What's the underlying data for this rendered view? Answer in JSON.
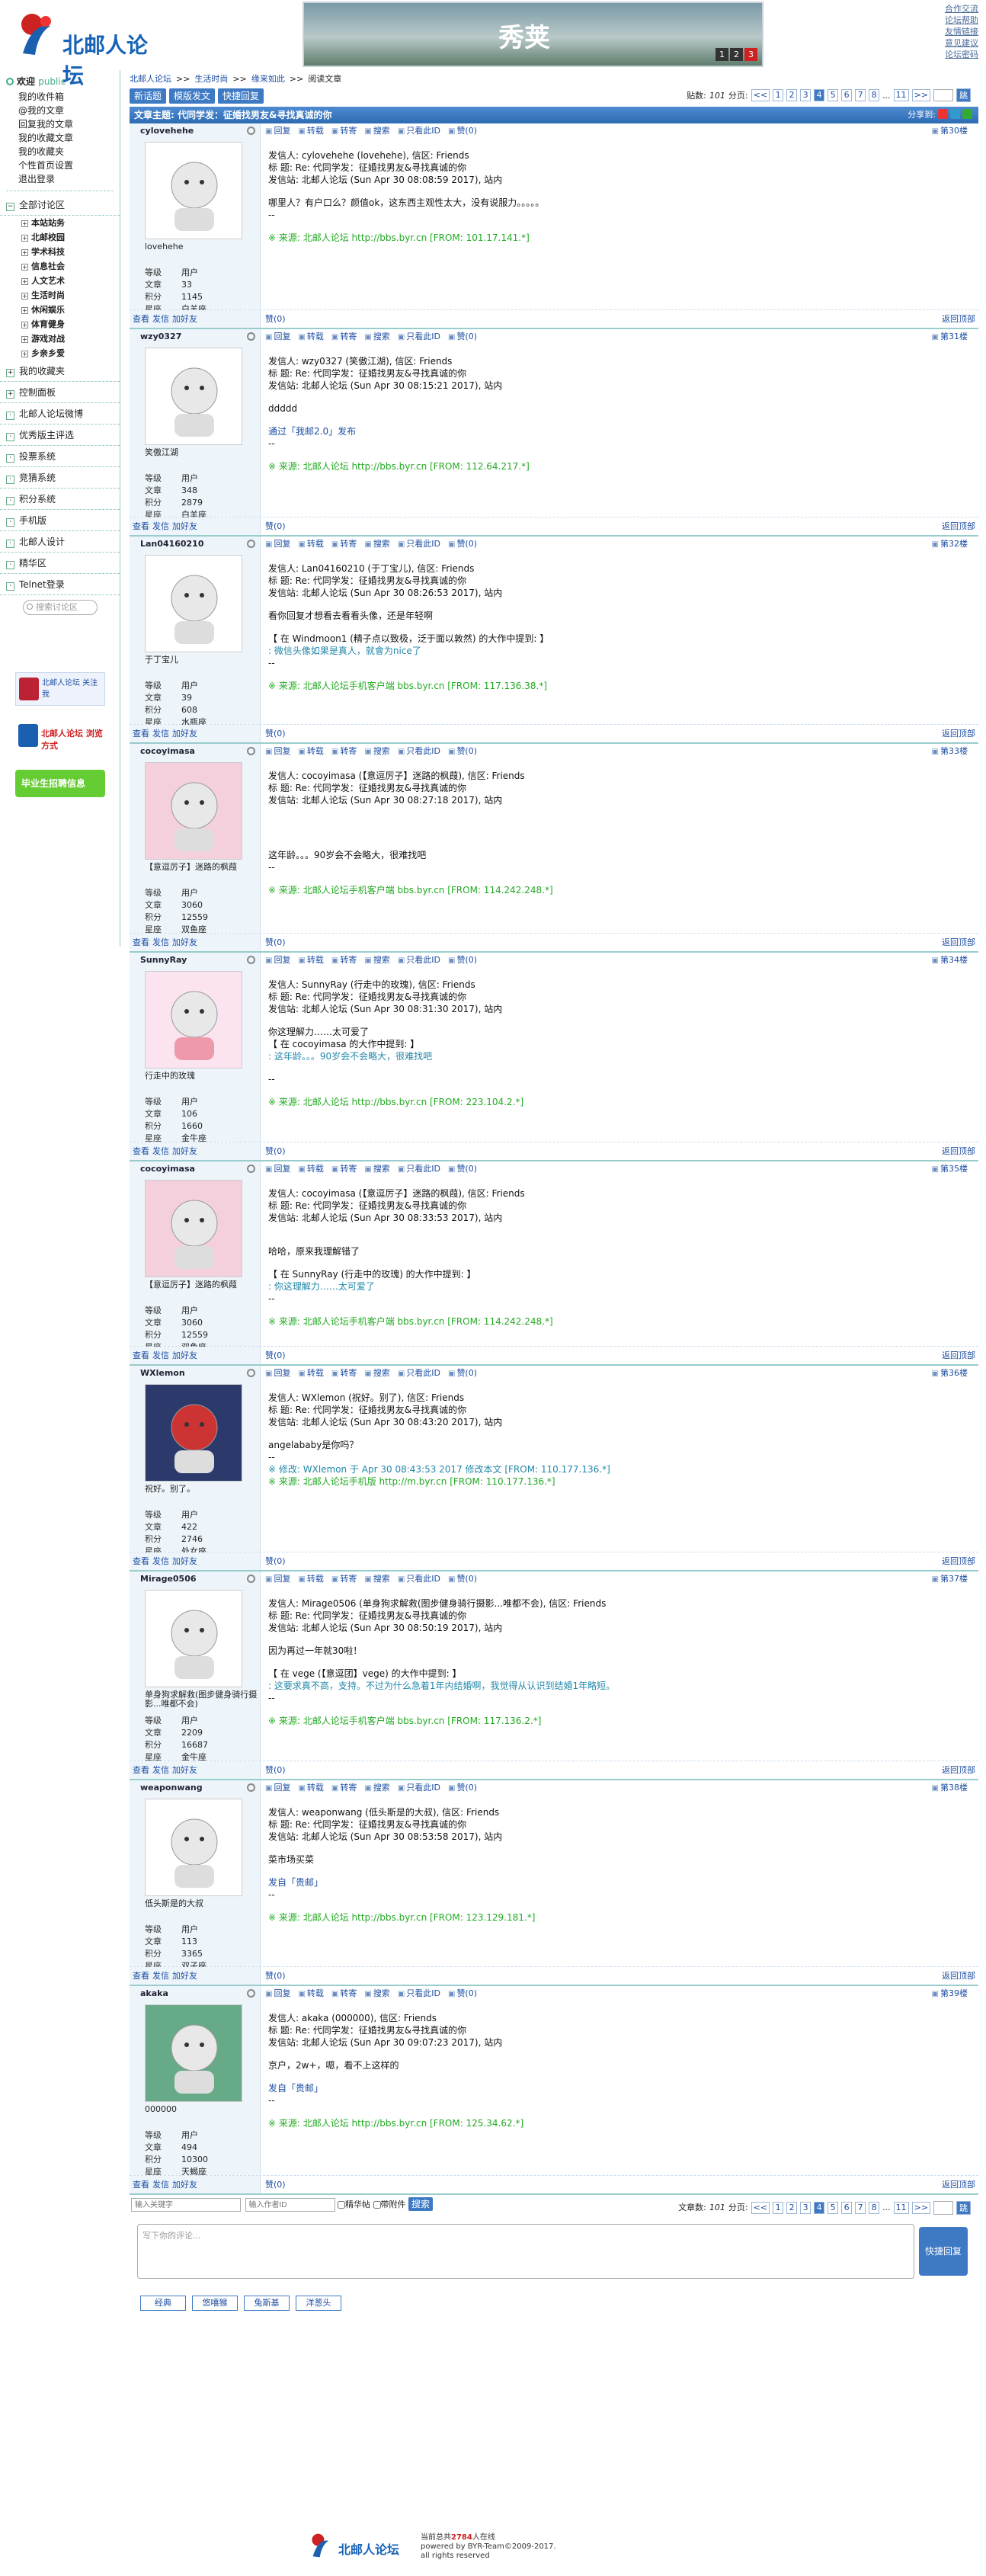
{
  "site": {
    "logo_text": "北邮人论坛",
    "banner_title": "秀荚",
    "banner_pages": [
      "1",
      "2",
      "3"
    ],
    "banner_current": "3",
    "toplinks": [
      "合作交流",
      "论坛帮助",
      "友情链接",
      "意见建议",
      "论坛密码"
    ]
  },
  "side": {
    "welcome": "欢迎",
    "user": "public",
    "mail": [
      "我的收件箱",
      "@我的文章",
      "回复我的文章",
      "我的收藏文章",
      "我的收藏夹",
      "个性首页设置",
      "退出登录"
    ],
    "boards_title": "全部讨论区",
    "boards": [
      "本站站务",
      "北邮校园",
      "学术科技",
      "信息社会",
      "人文艺术",
      "生活时尚",
      "休闲娱乐",
      "体育健身",
      "游戏对战",
      "乡亲乡爱"
    ],
    "sections": [
      "我的收藏夹",
      "控制面板",
      "北邮人论坛微博",
      "优秀版主评选",
      "投票系统",
      "竞猜系统",
      "积分系统",
      "手机版",
      "北邮人设计",
      "精华区",
      "Telnet登录"
    ],
    "search_placeholder": "搜索讨论区",
    "ads": [
      "北邮人论坛 关注我",
      "北邮人论坛 浏览方式",
      "毕业生招聘信息"
    ]
  },
  "crumb": [
    "北邮人论坛",
    "生活时尚",
    "缘来如此",
    "阅读文章"
  ],
  "toolbar": {
    "new": "新话题",
    "mail": "模版发文",
    "quick": "快捷回复",
    "count_label": "贴数:",
    "count": "101",
    "pages_label": "分页:",
    "prev": "<<",
    "pages": [
      "1",
      "2",
      "3",
      "4",
      "5",
      "6",
      "7",
      "8",
      "...",
      "11"
    ],
    "next": ">>",
    "current": "4",
    "go": "跳"
  },
  "topic": {
    "label": "文章主题: 代同学发：征婚找男友&寻找真诚的你",
    "share": "分享到:"
  },
  "actions": [
    "回复",
    "转载",
    "转寄",
    "搜索",
    "只看此ID",
    "赞(0)"
  ],
  "footer_actions": [
    "查看",
    "发信",
    "加好友"
  ],
  "back_top": "返回顶部",
  "stat_labels": [
    "等级",
    "文章",
    "积分",
    "星座"
  ],
  "posts": [
    {
      "id": "cylovehehe",
      "nick": "lovehehe",
      "stats": [
        "用户",
        "33",
        "1145",
        "白羊座"
      ],
      "floor": "第30楼",
      "like": "赞(0)",
      "lines": [
        "发信人: cylovehehe (lovehehe), 信区: Friends",
        "标  题: Re: 代同学发：征婚找男友&寻找真诚的你",
        "发信站: 北邮人论坛 (Sun Apr 30 08:08:59 2017), 站内",
        "",
        "哪里人？有户口么？颜值ok，这东西主观性太大，没有说服力。。。。。",
        "--",
        "",
        "※ 来源: 北邮人论坛 http://bbs.byr.cn [FROM: 101.17.141.*]"
      ]
    },
    {
      "id": "wzy0327",
      "nick": "笑傲江湖",
      "stats": [
        "用户",
        "348",
        "2879",
        "白羊座"
      ],
      "floor": "第31楼",
      "like": "赞(0)",
      "lines": [
        "发信人: wzy0327 (笑傲江湖), 信区: Friends",
        "标  题: Re: 代同学发：征婚找男友&寻找真诚的你",
        "发信站: 北邮人论坛 (Sun Apr 30 08:15:21 2017), 站内",
        "",
        "ddddd",
        "",
        "通过「我邮2.0」发布",
        "--",
        "",
        "※ 来源: 北邮人论坛 http://bbs.byr.cn [FROM: 112.64.217.*]"
      ]
    },
    {
      "id": "Lan04160210",
      "nick": "于丁宝儿",
      "stats": [
        "用户",
        "39",
        "608",
        "水瓶座"
      ],
      "floor": "第32楼",
      "like": "赞(0)",
      "lines": [
        "发信人: Lan04160210 (于丁宝儿), 信区: Friends",
        "标  题: Re: 代同学发：征婚找男友&寻找真诚的你",
        "发信站: 北邮人论坛 (Sun Apr 30 08:26:53 2017), 站内",
        "",
        "看你回复才想看去看看头像，还是年轻啊",
        "",
        "【 在 Windmoon1 (精子点以致极，泛于面以敦然) 的大作中提到: 】",
        ": 微信头像如果是真人，就會为nice了",
        "--",
        "",
        "※ 来源: 北邮人论坛手机客户端 bbs.byr.cn [FROM: 117.136.38.*]"
      ]
    },
    {
      "id": "cocoyimasa",
      "nick": "【意逗厉子】迷路的枫葭",
      "stats": [
        "用户",
        "3060",
        "12559",
        "双鱼座"
      ],
      "floor": "第33楼",
      "like": "赞(0)",
      "lines": [
        "发信人: cocoyimasa (【意逗厉子】迷路的枫葭), 信区: Friends",
        "标  题: Re: 代同学发：征婚找男友&寻找真诚的你",
        "发信站: 北邮人论坛 (Sun Apr 30 08:27:18 2017), 站内",
        "",
        "",
        "",
        "",
        "这年龄。。。90岁会不会略大，很难找吧",
        "--",
        "",
        "※ 来源: 北邮人论坛手机客户端 bbs.byr.cn [FROM: 114.242.248.*]"
      ]
    },
    {
      "id": "SunnyRay",
      "nick": "行走中的玫瑰",
      "stats": [
        "用户",
        "106",
        "1660",
        "金牛座"
      ],
      "floor": "第34楼",
      "like": "赞(0)",
      "lines": [
        "发信人: SunnyRay (行走中的玫瑰), 信区: Friends",
        "标  题: Re: 代同学发：征婚找男友&寻找真诚的你",
        "发信站: 北邮人论坛 (Sun Apr 30 08:31:30 2017), 站内",
        "",
        "你这理解力……太可爱了",
        "【 在 cocoyimasa 的大作中提到: 】",
        ": 这年龄。。。90岁会不会略大，很难找吧",
        "",
        "--",
        "",
        "※ 来源: 北邮人论坛 http://bbs.byr.cn [FROM: 223.104.2.*]"
      ]
    },
    {
      "id": "cocoyimasa",
      "nick": "【意逗厉子】迷路的枫葭",
      "stats": [
        "用户",
        "3060",
        "12559",
        "双鱼座"
      ],
      "floor": "第35楼",
      "like": "赞(0)",
      "lines": [
        "发信人: cocoyimasa (【意逗厉子】迷路的枫葭), 信区: Friends",
        "标  题: Re: 代同学发：征婚找男友&寻找真诚的你",
        "发信站: 北邮人论坛 (Sun Apr 30 08:33:53 2017), 站内",
        "",
        "",
        "哈哈，原来我理解错了",
        "",
        "【 在 SunnyRay (行走中的玫瑰) 的大作中提到: 】",
        ": 你这理解力……太可爱了",
        "--",
        "",
        "※ 来源: 北邮人论坛手机客户端 bbs.byr.cn [FROM: 114.242.248.*]"
      ]
    },
    {
      "id": "WXlemon",
      "nick": "祝好。别了。",
      "stats": [
        "用户",
        "422",
        "2746",
        "处女座"
      ],
      "floor": "第36楼",
      "like": "赞(0)",
      "lines": [
        "发信人: WXlemon (祝好。别了), 信区: Friends",
        "标  题: Re: 代同学发：征婚找男友&寻找真诚的你",
        "发信站: 北邮人论坛 (Sun Apr 30 08:43:20 2017), 站内",
        "",
        "angelababy是你吗？",
        "--",
        "※ 修改: WXlemon 于 Apr 30 08:43:53 2017 修改本文 [FROM: 110.177.136.*]",
        "※ 来源: 北邮人论坛手机版 http://m.byr.cn [FROM: 110.177.136.*]"
      ]
    },
    {
      "id": "Mirage0506",
      "nick": "单身狗求解救(图步健身骑行摄影...唯都不会)",
      "stats": [
        "用户",
        "2209",
        "16687",
        "金牛座"
      ],
      "floor": "第37楼",
      "like": "赞(0)",
      "lines": [
        "发信人: Mirage0506 (单身狗求解救(图步健身骑行摄影...唯都不会), 信区: Friends",
        "标  题: Re: 代同学发：征婚找男友&寻找真诚的你",
        "发信站: 北邮人论坛 (Sun Apr 30 08:50:19 2017), 站内",
        "",
        "因为再过一年就30啦！",
        "",
        "【 在 vege (【意逗团】vege) 的大作中提到: 】",
        ": 这要求真不高，支持。不过为什么急着1年内结婚啊，我觉得从认识到结婚1年略短。",
        "--",
        "",
        "※ 来源: 北邮人论坛手机客户端 bbs.byr.cn [FROM: 117.136.2.*]"
      ]
    },
    {
      "id": "weaponwang",
      "nick": "低头斯是的大叔",
      "stats": [
        "用户",
        "113",
        "3365",
        "双子座"
      ],
      "floor": "第38楼",
      "like": "赞(0)",
      "lines": [
        "发信人: weaponwang (低头斯是的大叔), 信区: Friends",
        "标  题: Re: 代同学发：征婚找男友&寻找真诚的你",
        "发信站: 北邮人论坛 (Sun Apr 30 08:53:58 2017), 站内",
        "",
        "菜市场买菜",
        "",
        "发自「贵邮」",
        "--",
        "",
        "※ 来源: 北邮人论坛 http://bbs.byr.cn [FROM: 123.129.181.*]"
      ]
    },
    {
      "id": "akaka",
      "nick": "000000",
      "stats": [
        "用户",
        "494",
        "10300",
        "天蝎座"
      ],
      "floor": "第39楼",
      "like": "赞(0)",
      "lines": [
        "发信人: akaka (000000), 信区: Friends",
        "标  题: Re: 代同学发：征婚找男友&寻找真诚的你",
        "发信站: 北邮人论坛 (Sun Apr 30 09:07:23 2017), 站内",
        "",
        "京户，2w+，嗯，看不上这样的",
        "",
        "发自「贵邮」",
        "--",
        "",
        "※ 来源: 北邮人论坛 http://bbs.byr.cn [FROM: 125.34.62.*]"
      ]
    }
  ],
  "bottom": {
    "kw": "输入关键字",
    "au": "输入作者ID",
    "check1": "精华帖",
    "check2": "带附件",
    "search": "搜索",
    "count_label": "文章数:",
    "count": "101"
  },
  "reply": {
    "placeholder": "写下你的评论...",
    "button": "快捷回复",
    "emotions": [
      "经典",
      "悠嘻猴",
      "兔斯基",
      "洋葱头"
    ]
  },
  "footer": {
    "online_pre": "当前总共",
    "online": "2784",
    "online_post": "人在线",
    "powered": "powered by BYR-Team©2009-2017.",
    "rights": "all rights reserved"
  }
}
